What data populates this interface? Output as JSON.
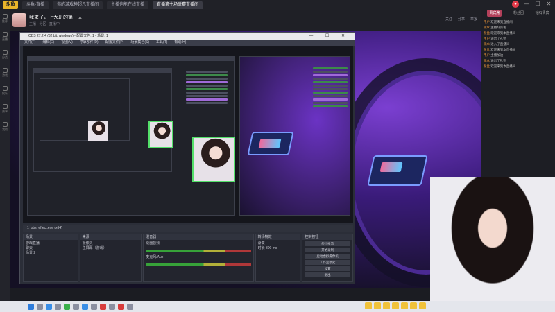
{
  "browser": {
    "logo": "斗鱼",
    "tabs": [
      "斗鱼-直播",
      "你的游戏神超凡直播间",
      "主播也能在线直播",
      "直播第十场联赛直播间"
    ],
    "active_tab_index": 3,
    "window_controls": [
      "—",
      "☐",
      "✕"
    ]
  },
  "header": {
    "title": "我来了，上大班的第一天",
    "subtitle": "主播 · 分区 · 直播中",
    "right_items": [
      "关注",
      "分享",
      "举报"
    ]
  },
  "rail_items": [
    "推荐",
    "直播",
    "分类",
    "游戏",
    "娱乐",
    "赛事",
    "我的"
  ],
  "obs": {
    "title": "OBS 27.2.4 (32 bit, windows) - 配置文件: 1 - 场景: 1",
    "menu": [
      "文件(F)",
      "编辑(E)",
      "视图(V)",
      "停靠部件(D)",
      "配置文件(P)",
      "场景集合(S)",
      "工具(T)",
      "帮助(H)"
    ],
    "scene_bar": "1_obs_effect.exe (x64)",
    "docks": {
      "scenes": {
        "title": "场景",
        "items": [
          "游戏直播",
          "聊天",
          "场景 2"
        ]
      },
      "sources": {
        "title": "来源",
        "items": [
          "摄像头",
          "主屏幕（游戏）"
        ]
      },
      "mixer": {
        "title": "混音器",
        "items": [
          "桌面音频",
          "麦克风/Aux"
        ]
      },
      "transitions": {
        "title": "转场特效",
        "items": [
          "渐变",
          "时长 300 ms"
        ]
      },
      "controls": {
        "title": "控制按钮",
        "items": [
          "停止推流",
          "开始录制",
          "启动虚拟摄像机",
          "工作室模式",
          "设置",
          "退出"
        ]
      }
    }
  },
  "chat": {
    "tabs": [
      "贵宾席",
      "粉丝团",
      "钻石贵宾"
    ],
    "active_tab_index": 0,
    "messages": [
      {
        "user": "用户",
        "text": "欢迎来到直播间"
      },
      {
        "user": "观众",
        "text": "主播好厉害"
      },
      {
        "user": "粉丝",
        "text": "欢迎来到本直播间"
      },
      {
        "user": "用户",
        "text": "送出了礼物"
      },
      {
        "user": "观众",
        "text": "进入了直播间"
      },
      {
        "user": "粉丝",
        "text": "欢迎来到本直播间"
      },
      {
        "user": "用户",
        "text": "主播加油"
      },
      {
        "user": "观众",
        "text": "送出了礼物"
      },
      {
        "user": "粉丝",
        "text": "欢迎来到本直播间"
      }
    ]
  }
}
